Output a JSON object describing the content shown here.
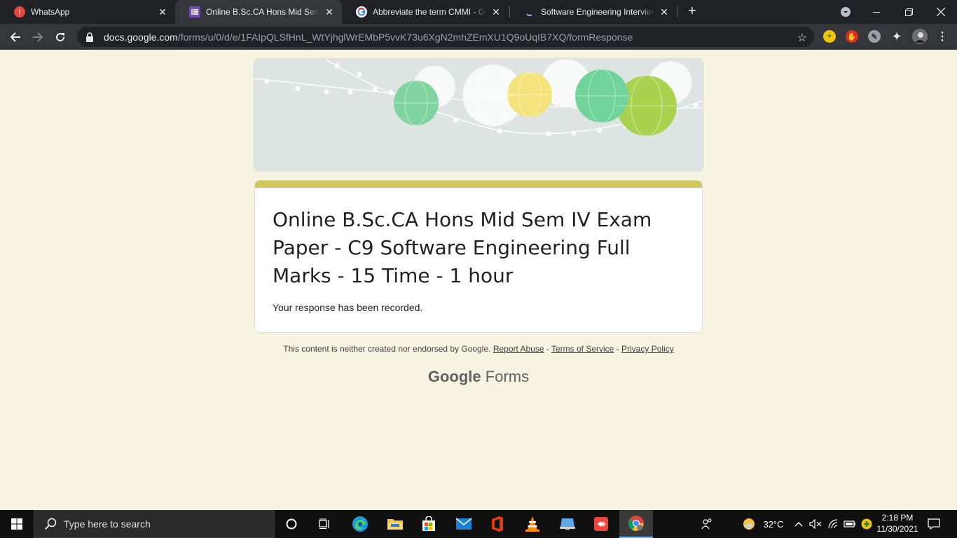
{
  "browser": {
    "tabs": [
      {
        "title": "WhatsApp",
        "active": false
      },
      {
        "title": "Online B.Sc.CA Hons Mid Sem IV",
        "active": true
      },
      {
        "title": "Abbreviate the term CMMI - Goo",
        "active": false
      },
      {
        "title": "Software Engineering Interview Q",
        "active": false
      }
    ],
    "close_glyph": "✕",
    "new_tab_glyph": "+",
    "url_host": "docs.google.com",
    "url_path": "/forms/u/0/d/e/1FAIpQLSfHnL_WtYjhglWrEMbP5vvK73u6XgN2mhZEmXU1Q9oUqIB7XQ/formResponse"
  },
  "form": {
    "title": "Online B.Sc.CA Hons Mid Sem IV Exam Paper - C9 Software Engineering Full Marks - 15 Time - 1 hour",
    "confirmation": "Your response has been recorded.",
    "accent_color": "#d1c55c",
    "background_color": "#f6f3e1"
  },
  "footer": {
    "disclaimer": "This content is neither created nor endorsed by Google.",
    "report_abuse": "Report Abuse",
    "separator": " - ",
    "terms": "Terms of Service",
    "privacy": "Privacy Policy",
    "brand_google": "Google",
    "brand_forms": " Forms"
  },
  "taskbar": {
    "search_placeholder": "Type here to search",
    "temperature": "32°C",
    "time": "2:18 PM",
    "date": "11/30/2021"
  }
}
